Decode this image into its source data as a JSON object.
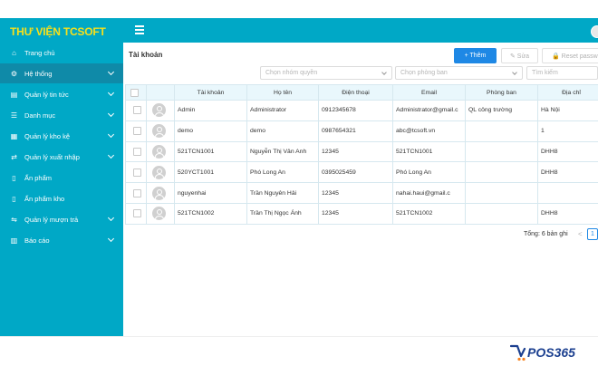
{
  "header": {
    "logo_text": "THƯ VIỆN TCSOFT"
  },
  "sidebar": {
    "items": [
      {
        "label": "Trang chủ",
        "icon": "home-icon",
        "glyph": "⌂",
        "has_children": false,
        "active": false
      },
      {
        "label": "Hệ thống",
        "icon": "gear-icon",
        "glyph": "⚙",
        "has_children": true,
        "active": true
      },
      {
        "label": "Quản lý tin tức",
        "icon": "news-icon",
        "glyph": "▤",
        "has_children": true,
        "active": false
      },
      {
        "label": "Danh mục",
        "icon": "list-icon",
        "glyph": "☰",
        "has_children": true,
        "active": false
      },
      {
        "label": "Quản lý kho kệ",
        "icon": "shelf-icon",
        "glyph": "▦",
        "has_children": true,
        "active": false
      },
      {
        "label": "Quản lý xuất nhập",
        "icon": "exchange-icon",
        "glyph": "⇄",
        "has_children": true,
        "active": false
      },
      {
        "label": "Ấn phẩm",
        "icon": "book-icon",
        "glyph": "▯",
        "has_children": false,
        "active": false
      },
      {
        "label": "Ấn phẩm kho",
        "icon": "book-stack-icon",
        "glyph": "▯",
        "has_children": false,
        "active": false
      },
      {
        "label": "Quản lý mượn trả",
        "icon": "swap-icon",
        "glyph": "⇋",
        "has_children": true,
        "active": false
      },
      {
        "label": "Báo cáo",
        "icon": "chart-icon",
        "glyph": "▥",
        "has_children": true,
        "active": false
      }
    ]
  },
  "main": {
    "title": "Tài khoản",
    "buttons": {
      "add": "+ Thêm",
      "edit": "✎ Sửa",
      "reset": "🔒 Reset password"
    },
    "filters": {
      "group_placeholder": "Chọn nhóm quyền",
      "department_placeholder": "Chọn phòng ban",
      "search_placeholder": "Tìm kiếm"
    },
    "table": {
      "columns": [
        "Tài khoản",
        "Họ tên",
        "Điện thoại",
        "Email",
        "Phòng ban",
        "Địa chỉ"
      ],
      "rows": [
        [
          "Admin",
          "Administrator",
          "0912345678",
          "Administrator@gmail.c",
          "QL công trường",
          "Hà Nội"
        ],
        [
          "demo",
          "demo",
          "0987654321",
          "abc@tcsoft.vn",
          "",
          "1"
        ],
        [
          "521TCN1001",
          "Nguyễn Thị Vân Anh",
          "12345",
          "521TCN1001",
          "",
          "DHH8"
        ],
        [
          "520YCT1001",
          "Phó Long An",
          "0395025459",
          "Phó Long An",
          "",
          "DHH8"
        ],
        [
          "nguyenhai",
          "Trần Nguyên Hải",
          "12345",
          "nahai.haui@gmail.c",
          "",
          ""
        ],
        [
          "521TCN1002",
          "Trần Thị Ngọc Ánh",
          "12345",
          "521TCN1002",
          "",
          "DHH8"
        ]
      ]
    },
    "pagination": {
      "total_text": "Tổng: 6 bản ghi",
      "prev": "<",
      "current_page": "1"
    }
  },
  "brand": {
    "text": "POS365"
  },
  "colors": {
    "primary": "#00a8c6",
    "sidebar_active": "#0f8aa8",
    "logo": "#f7e01b",
    "accent_button": "#1e88e5",
    "brand_blue": "#1b3f8f",
    "brand_orange": "#f58220"
  }
}
